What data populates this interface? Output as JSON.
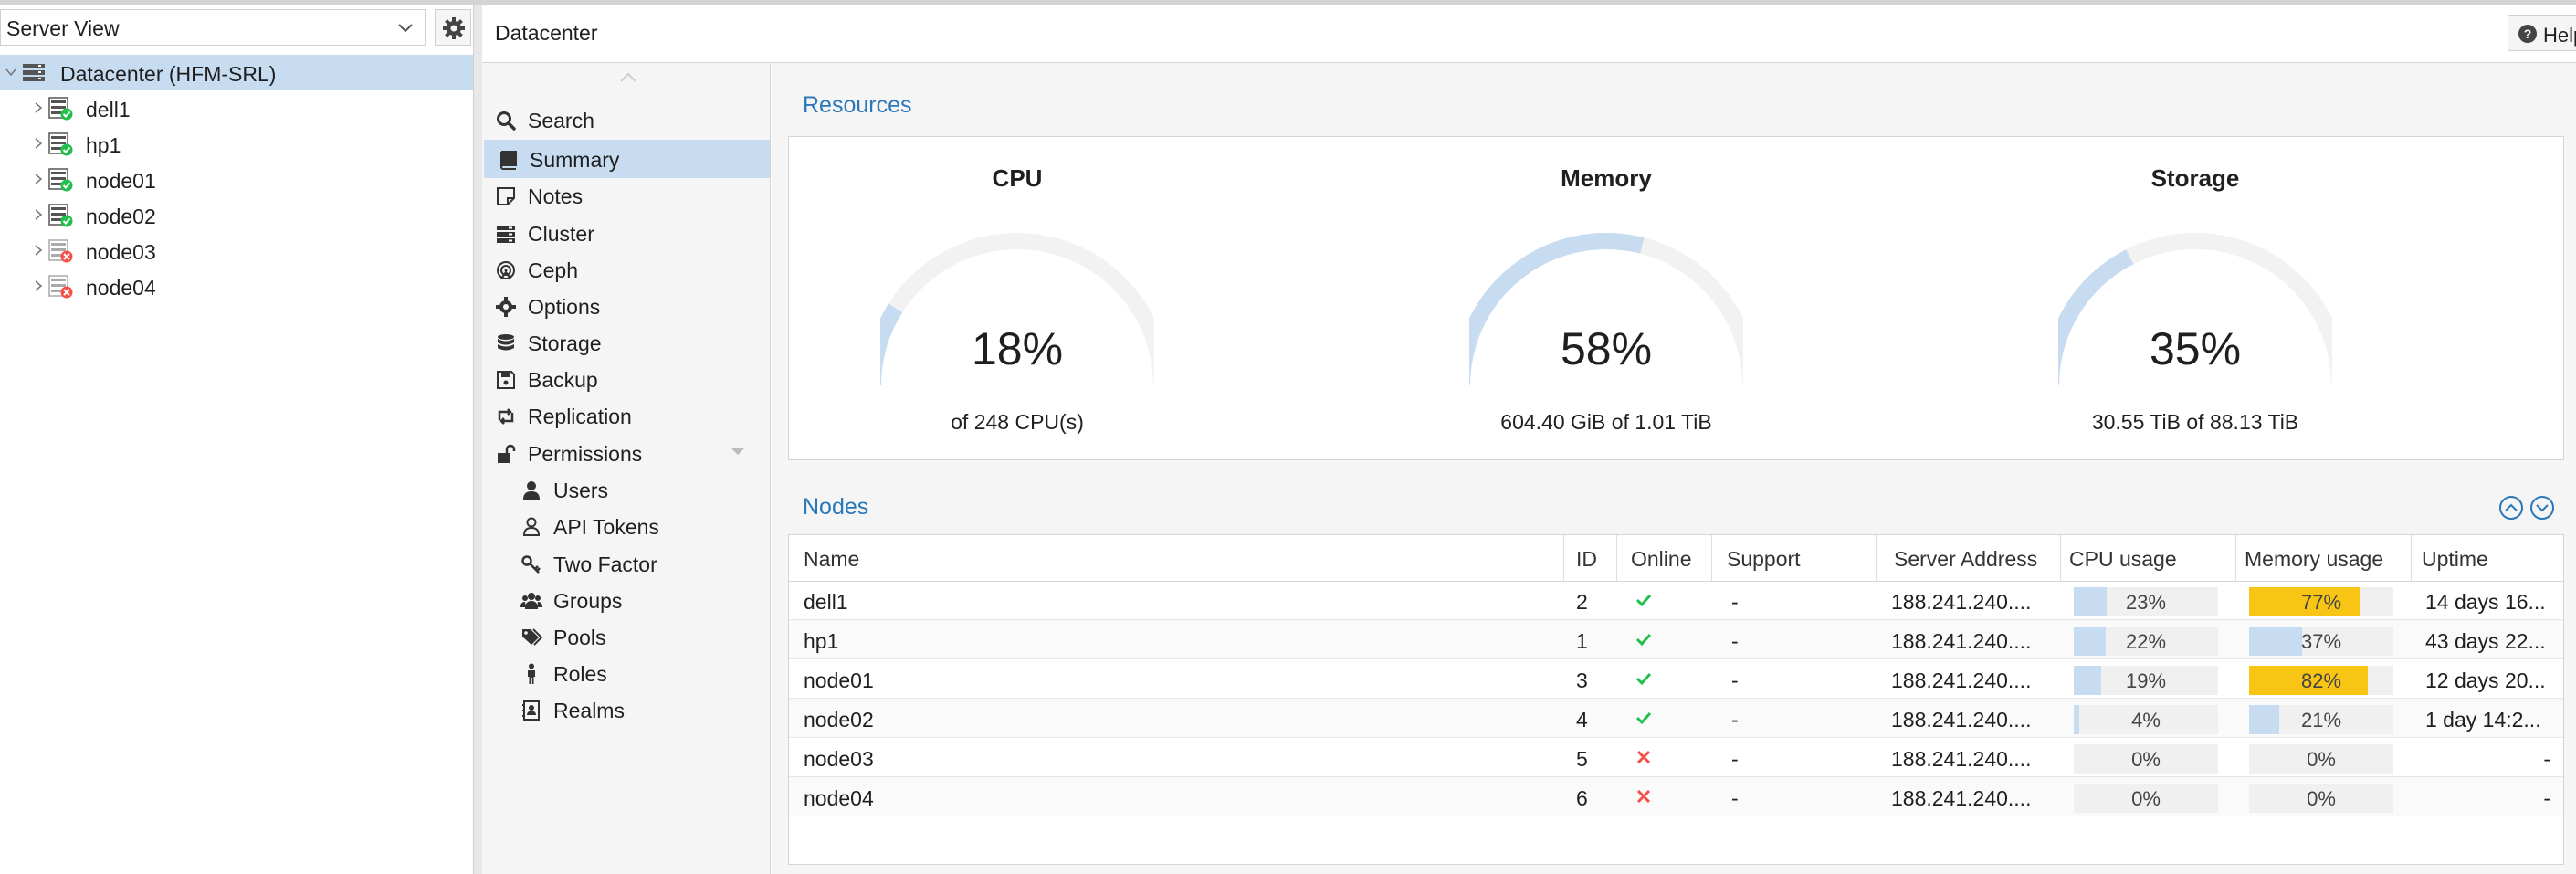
{
  "tree": {
    "view_select": "Server View",
    "items": [
      {
        "label": "Datacenter (HFM-SRL)",
        "icon": "datacenter-icon",
        "status": "none",
        "selected": true
      },
      {
        "label": "dell1",
        "icon": "node-icon",
        "status": "online"
      },
      {
        "label": "hp1",
        "icon": "node-icon",
        "status": "online"
      },
      {
        "label": "node01",
        "icon": "node-icon",
        "status": "online"
      },
      {
        "label": "node02",
        "icon": "node-icon",
        "status": "online"
      },
      {
        "label": "node03",
        "icon": "node-icon",
        "status": "offline"
      },
      {
        "label": "node04",
        "icon": "node-icon",
        "status": "offline"
      }
    ]
  },
  "header": {
    "title": "Datacenter",
    "help_label": "Help"
  },
  "menu": {
    "items": [
      {
        "label": "Search",
        "icon": "search-icon",
        "selected": false,
        "indent": false
      },
      {
        "label": "Summary",
        "icon": "book-icon",
        "selected": true,
        "indent": false
      },
      {
        "label": "Notes",
        "icon": "sticky-note-icon",
        "selected": false,
        "indent": false
      },
      {
        "label": "Cluster",
        "icon": "server-icon",
        "selected": false,
        "indent": false
      },
      {
        "label": "Ceph",
        "icon": "ceph-icon",
        "selected": false,
        "indent": false
      },
      {
        "label": "Options",
        "icon": "gear-icon",
        "selected": false,
        "indent": false
      },
      {
        "label": "Storage",
        "icon": "database-icon",
        "selected": false,
        "indent": false
      },
      {
        "label": "Backup",
        "icon": "floppy-icon",
        "selected": false,
        "indent": false
      },
      {
        "label": "Replication",
        "icon": "retweet-icon",
        "selected": false,
        "indent": false
      },
      {
        "label": "Permissions",
        "icon": "unlock-icon",
        "selected": false,
        "indent": false,
        "expandable": true
      },
      {
        "label": "Users",
        "icon": "user-icon",
        "selected": false,
        "indent": true
      },
      {
        "label": "API Tokens",
        "icon": "user-outline-icon",
        "selected": false,
        "indent": true
      },
      {
        "label": "Two Factor",
        "icon": "key-icon",
        "selected": false,
        "indent": true
      },
      {
        "label": "Groups",
        "icon": "users-icon",
        "selected": false,
        "indent": true
      },
      {
        "label": "Pools",
        "icon": "tags-icon",
        "selected": false,
        "indent": true
      },
      {
        "label": "Roles",
        "icon": "male-icon",
        "selected": false,
        "indent": true
      },
      {
        "label": "Realms",
        "icon": "address-book-icon",
        "selected": false,
        "indent": true
      }
    ]
  },
  "resources": {
    "title": "Resources",
    "gauges": [
      {
        "title": "CPU",
        "value_text": "18%",
        "value": 0.18,
        "subtitle": "of 248 CPU(s)"
      },
      {
        "title": "Memory",
        "value_text": "58%",
        "value": 0.58,
        "subtitle": "604.40 GiB of 1.01 TiB"
      },
      {
        "title": "Storage",
        "value_text": "35%",
        "value": 0.35,
        "subtitle": "30.55 TiB of 88.13 TiB"
      }
    ]
  },
  "nodes": {
    "title": "Nodes",
    "columns": [
      "Name",
      "ID",
      "Online",
      "Support",
      "Server Address",
      "CPU usage",
      "Memory usage",
      "Uptime"
    ],
    "rows": [
      {
        "name": "dell1",
        "id": "2",
        "online": true,
        "support": "-",
        "address": "188.241.240....",
        "cpu": 23,
        "cpu_text": "23%",
        "mem": 77,
        "mem_text": "77%",
        "uptime": "14 days 16..."
      },
      {
        "name": "hp1",
        "id": "1",
        "online": true,
        "support": "-",
        "address": "188.241.240....",
        "cpu": 22,
        "cpu_text": "22%",
        "mem": 37,
        "mem_text": "37%",
        "uptime": "43 days 22..."
      },
      {
        "name": "node01",
        "id": "3",
        "online": true,
        "support": "-",
        "address": "188.241.240....",
        "cpu": 19,
        "cpu_text": "19%",
        "mem": 82,
        "mem_text": "82%",
        "uptime": "12 days 20..."
      },
      {
        "name": "node02",
        "id": "4",
        "online": true,
        "support": "-",
        "address": "188.241.240....",
        "cpu": 4,
        "cpu_text": "4%",
        "mem": 21,
        "mem_text": "21%",
        "uptime": "1 day 14:2..."
      },
      {
        "name": "node03",
        "id": "5",
        "online": false,
        "support": "-",
        "address": "188.241.240....",
        "cpu": 0,
        "cpu_text": "0%",
        "mem": 0,
        "mem_text": "0%",
        "uptime": "-"
      },
      {
        "name": "node04",
        "id": "6",
        "online": false,
        "support": "-",
        "address": "188.241.240....",
        "cpu": 0,
        "cpu_text": "0%",
        "mem": 0,
        "mem_text": "0%",
        "uptime": "-"
      }
    ]
  },
  "colors": {
    "accent": "#2a77b9",
    "selection": "#c7dcf0",
    "gauge_fill": "#c7dcf0",
    "gauge_track": "#f2f2f2",
    "warning": "#f8c515",
    "ok": "#21bf4b",
    "error": "#f54f47"
  }
}
